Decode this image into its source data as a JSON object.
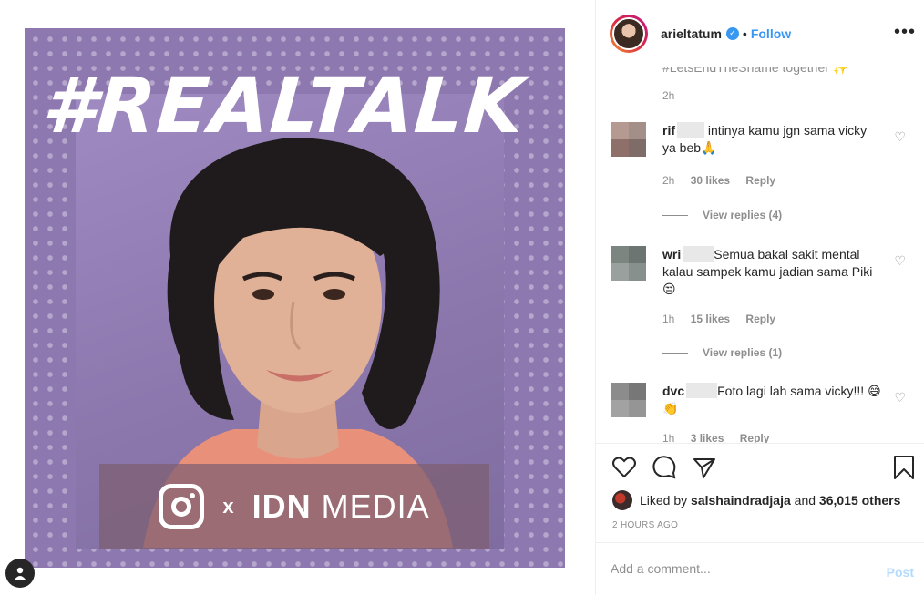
{
  "post": {
    "hashtag": "#REALTALK",
    "brand_x": "x",
    "brand_name_bold": "IDN",
    "brand_name_rest": " MEDIA"
  },
  "header": {
    "username": "arieltatum",
    "separator": "•",
    "follow_label": "Follow",
    "more_label": "•••"
  },
  "comments_area": {
    "cut_text": "#LetsEndTheShame together ✨",
    "caption_time": "2h",
    "items": [
      {
        "user": "rif",
        "text": "intinya kamu jgn sama vicky ya beb🙏",
        "time": "2h",
        "likes": "30 likes",
        "reply_label": "Reply",
        "view_replies": "View replies (4)",
        "avatar_colors": [
          "#b59a92",
          "#a38e88",
          "#8f6f6a",
          "#7e6c69"
        ]
      },
      {
        "user": "wri",
        "text": "Semua bakal sakit mental kalau sampek kamu jadian sama Piki 😒",
        "time": "1h",
        "likes": "15 likes",
        "reply_label": "Reply",
        "view_replies": "View replies (1)",
        "avatar_colors": [
          "#7d8581",
          "#6c7571",
          "#9aa09d",
          "#87908c"
        ]
      },
      {
        "user": "dvc",
        "text": "Foto lagi lah sama vicky!!! 😅👏",
        "time": "1h",
        "likes": "3 likes",
        "reply_label": "Reply",
        "avatar_colors": [
          "#8c8c8c",
          "#777777",
          "#a2a2a2",
          "#959595"
        ]
      }
    ]
  },
  "likes": {
    "prefix": "Liked by ",
    "user": "salshaindradjaja",
    "middle": " and ",
    "count": "36,015 others"
  },
  "time_ago": "2 HOURS AGO",
  "add_comment": {
    "placeholder": "Add a comment...",
    "post_label": "Post"
  },
  "icons": [
    "heart-icon",
    "comment-icon",
    "share-icon",
    "bookmark-icon",
    "verified-icon",
    "profile-icon"
  ]
}
